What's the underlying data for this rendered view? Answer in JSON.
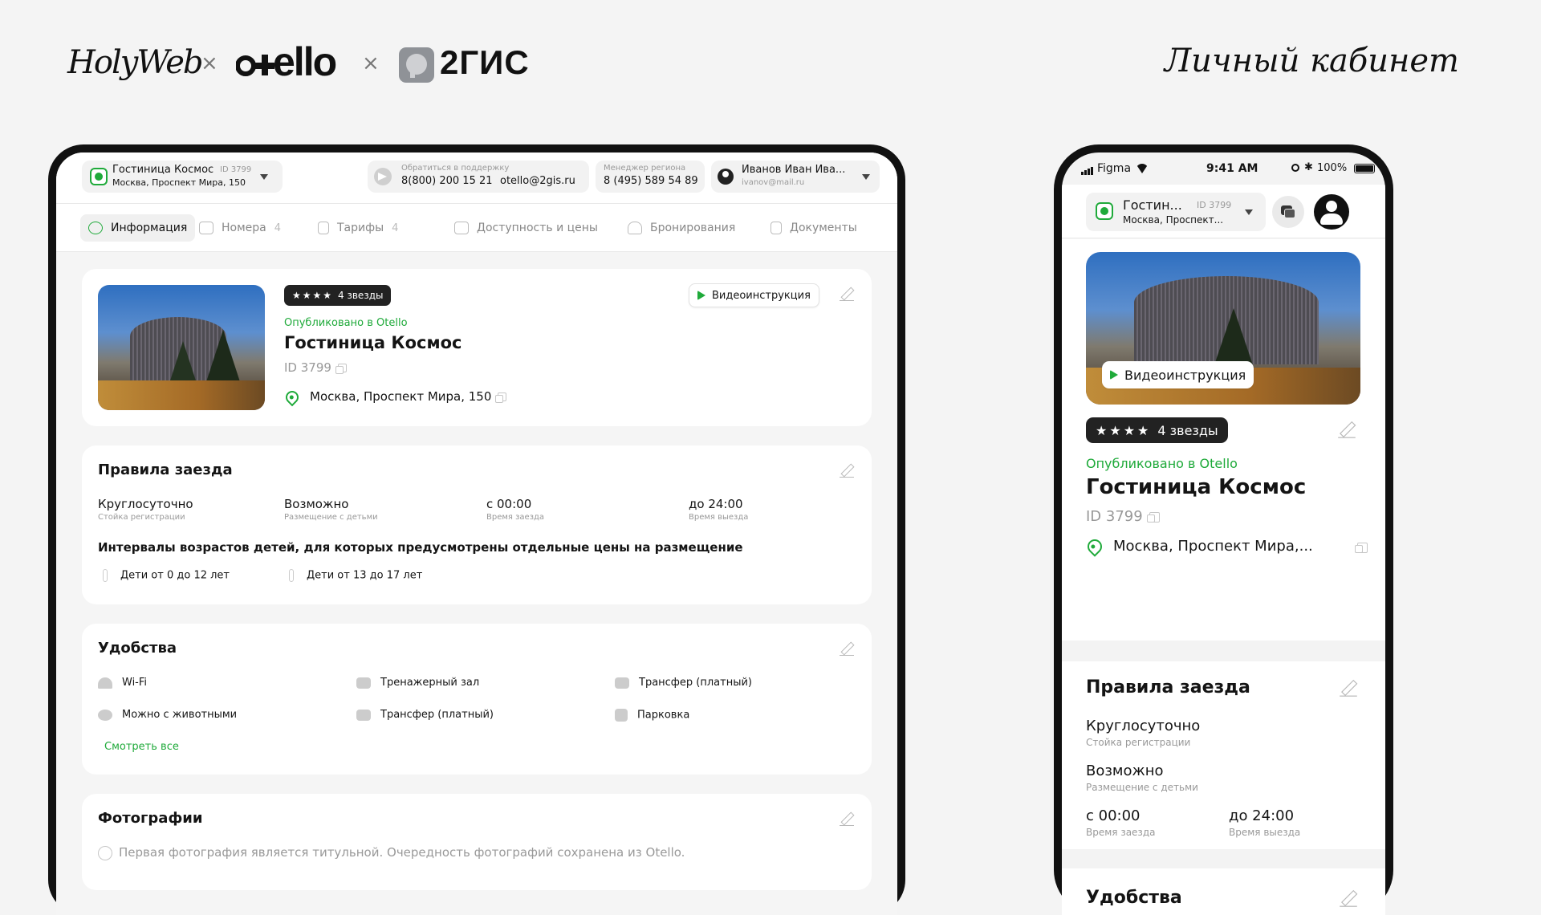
{
  "brand": {
    "holyweb": "HolyWeb",
    "times": "×",
    "otello": "o ello",
    "gis": "2ГИС",
    "page_title": "Личный кабинет"
  },
  "tablet": {
    "hotel_selector": {
      "name": "Гостиница Космос",
      "id": "ID 3799",
      "address": "Москва, Проспект Мира, 150"
    },
    "support": {
      "label": "Обратиться в поддержку",
      "phone": "8(800) 200 15 21",
      "email": "otello@2gis.ru"
    },
    "manager": {
      "label": "Менеджер региона",
      "phone": "8 (495) 589 54 89"
    },
    "user": {
      "name": "Иванов Иван Ива...",
      "email": "ivanov@mail.ru"
    },
    "tabs": [
      {
        "label": "Информация",
        "count": ""
      },
      {
        "label": "Номера",
        "count": "4"
      },
      {
        "label": "Тарифы",
        "count": "4"
      },
      {
        "label": "Доступность и цены",
        "count": ""
      },
      {
        "label": "Бронирования",
        "count": ""
      },
      {
        "label": "Документы",
        "count": ""
      }
    ],
    "hotel_card": {
      "stars": "★★★★",
      "stars_label": "4 звезды",
      "published": "Опубликовано в Otello",
      "name": "Гостиница Космос",
      "id": "ID 3799",
      "address": "Москва, Проспект Мира, 150",
      "video_btn": "Видеоинструкция"
    },
    "rules": {
      "title": "Правила заезда",
      "items": [
        {
          "value": "Круглосуточно",
          "caption": "Стойка регистрации"
        },
        {
          "value": "Возможно",
          "caption": "Размещение с детьми"
        },
        {
          "value": "с 00:00",
          "caption": "Время заезда"
        },
        {
          "value": "до 24:00",
          "caption": "Время выезда"
        }
      ],
      "children_title": "Интервалы возрастов детей, для которых предусмотрены отдельные цены на размещение",
      "children": [
        "Дети от 0 до 12 лет",
        "Дети от 13 до 17 лет"
      ]
    },
    "amenities": {
      "title": "Удобства",
      "items": [
        "Wi-Fi",
        "Тренажерный зал",
        "Трансфер (платный)",
        "Можно с животными",
        "Трансфер (платный)",
        "Парковка"
      ],
      "see_all": "Смотреть все"
    },
    "photos": {
      "title": "Фотографии",
      "note": "Первая фотография является титульной. Очередность фотографий сохранена из Otello."
    }
  },
  "phone": {
    "status": {
      "carrier": "Figma",
      "time": "9:41 AM",
      "battery": "100%"
    },
    "hotel_selector": {
      "name": "Гостин...",
      "id": "ID 3799",
      "address": "Москва, Проспект..."
    },
    "hotel_card": {
      "video_btn": "Видеоинструкция",
      "stars": "★★★★",
      "stars_label": "4 звезды",
      "published": "Опубликовано в Otello",
      "name": "Гостиница Космос",
      "id": "ID 3799",
      "address": "Москва, Проспект Мира,..."
    },
    "rules": {
      "title": "Правила заезда",
      "items": [
        {
          "value": "Круглосуточно",
          "caption": "Стойка регистрации"
        },
        {
          "value": "Возможно",
          "caption": "Размещение с детьми"
        },
        {
          "value": "с 00:00",
          "caption": "Время заезда"
        },
        {
          "value": "до 24:00",
          "caption": "Время выезда"
        }
      ]
    },
    "amenities": {
      "title": "Удобства"
    }
  },
  "colors": {
    "accent": "#1faa3a",
    "dark": "#141414",
    "muted": "#999999"
  }
}
